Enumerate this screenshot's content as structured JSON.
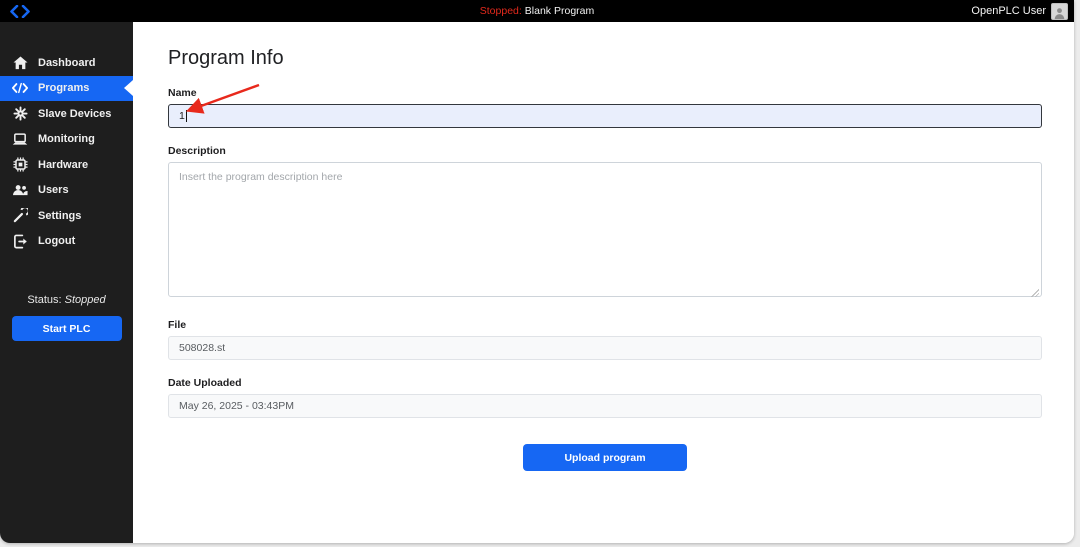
{
  "app": {
    "topbar": {
      "logo_icon": "code-brackets-icon",
      "status_prefix": "Stopped:",
      "status_program": "Blank Program",
      "user_label": "OpenPLC User"
    },
    "sidebar": {
      "items": [
        {
          "label": "Dashboard",
          "icon": "home-icon"
        },
        {
          "label": "Programs",
          "icon": "code-icon"
        },
        {
          "label": "Slave Devices",
          "icon": "spider-icon"
        },
        {
          "label": "Monitoring",
          "icon": "laptop-icon"
        },
        {
          "label": "Hardware",
          "icon": "chip-icon"
        },
        {
          "label": "Users",
          "icon": "users-icon"
        },
        {
          "label": "Settings",
          "icon": "wrench-icon"
        },
        {
          "label": "Logout",
          "icon": "logout-icon"
        }
      ],
      "active_item": "Programs",
      "status_label": "Status:",
      "status_value": "Stopped",
      "start_button_label": "Start PLC"
    },
    "main": {
      "title": "Program Info",
      "fields": {
        "name": {
          "label": "Name",
          "value": "1"
        },
        "description": {
          "label": "Description",
          "placeholder": "Insert the program description here",
          "value": ""
        },
        "file": {
          "label": "File",
          "value": "508028.st"
        },
        "date": {
          "label": "Date Uploaded",
          "value": "May 26, 2025 - 03:43PM"
        }
      },
      "upload_button_label": "Upload program"
    },
    "colors": {
      "accent_blue": "#1667f3",
      "status_red": "#e2291c",
      "topbar_black": "#000000",
      "sidebar_dark": "#1e1e1e",
      "focused_input_bg": "#e9eefc"
    }
  }
}
